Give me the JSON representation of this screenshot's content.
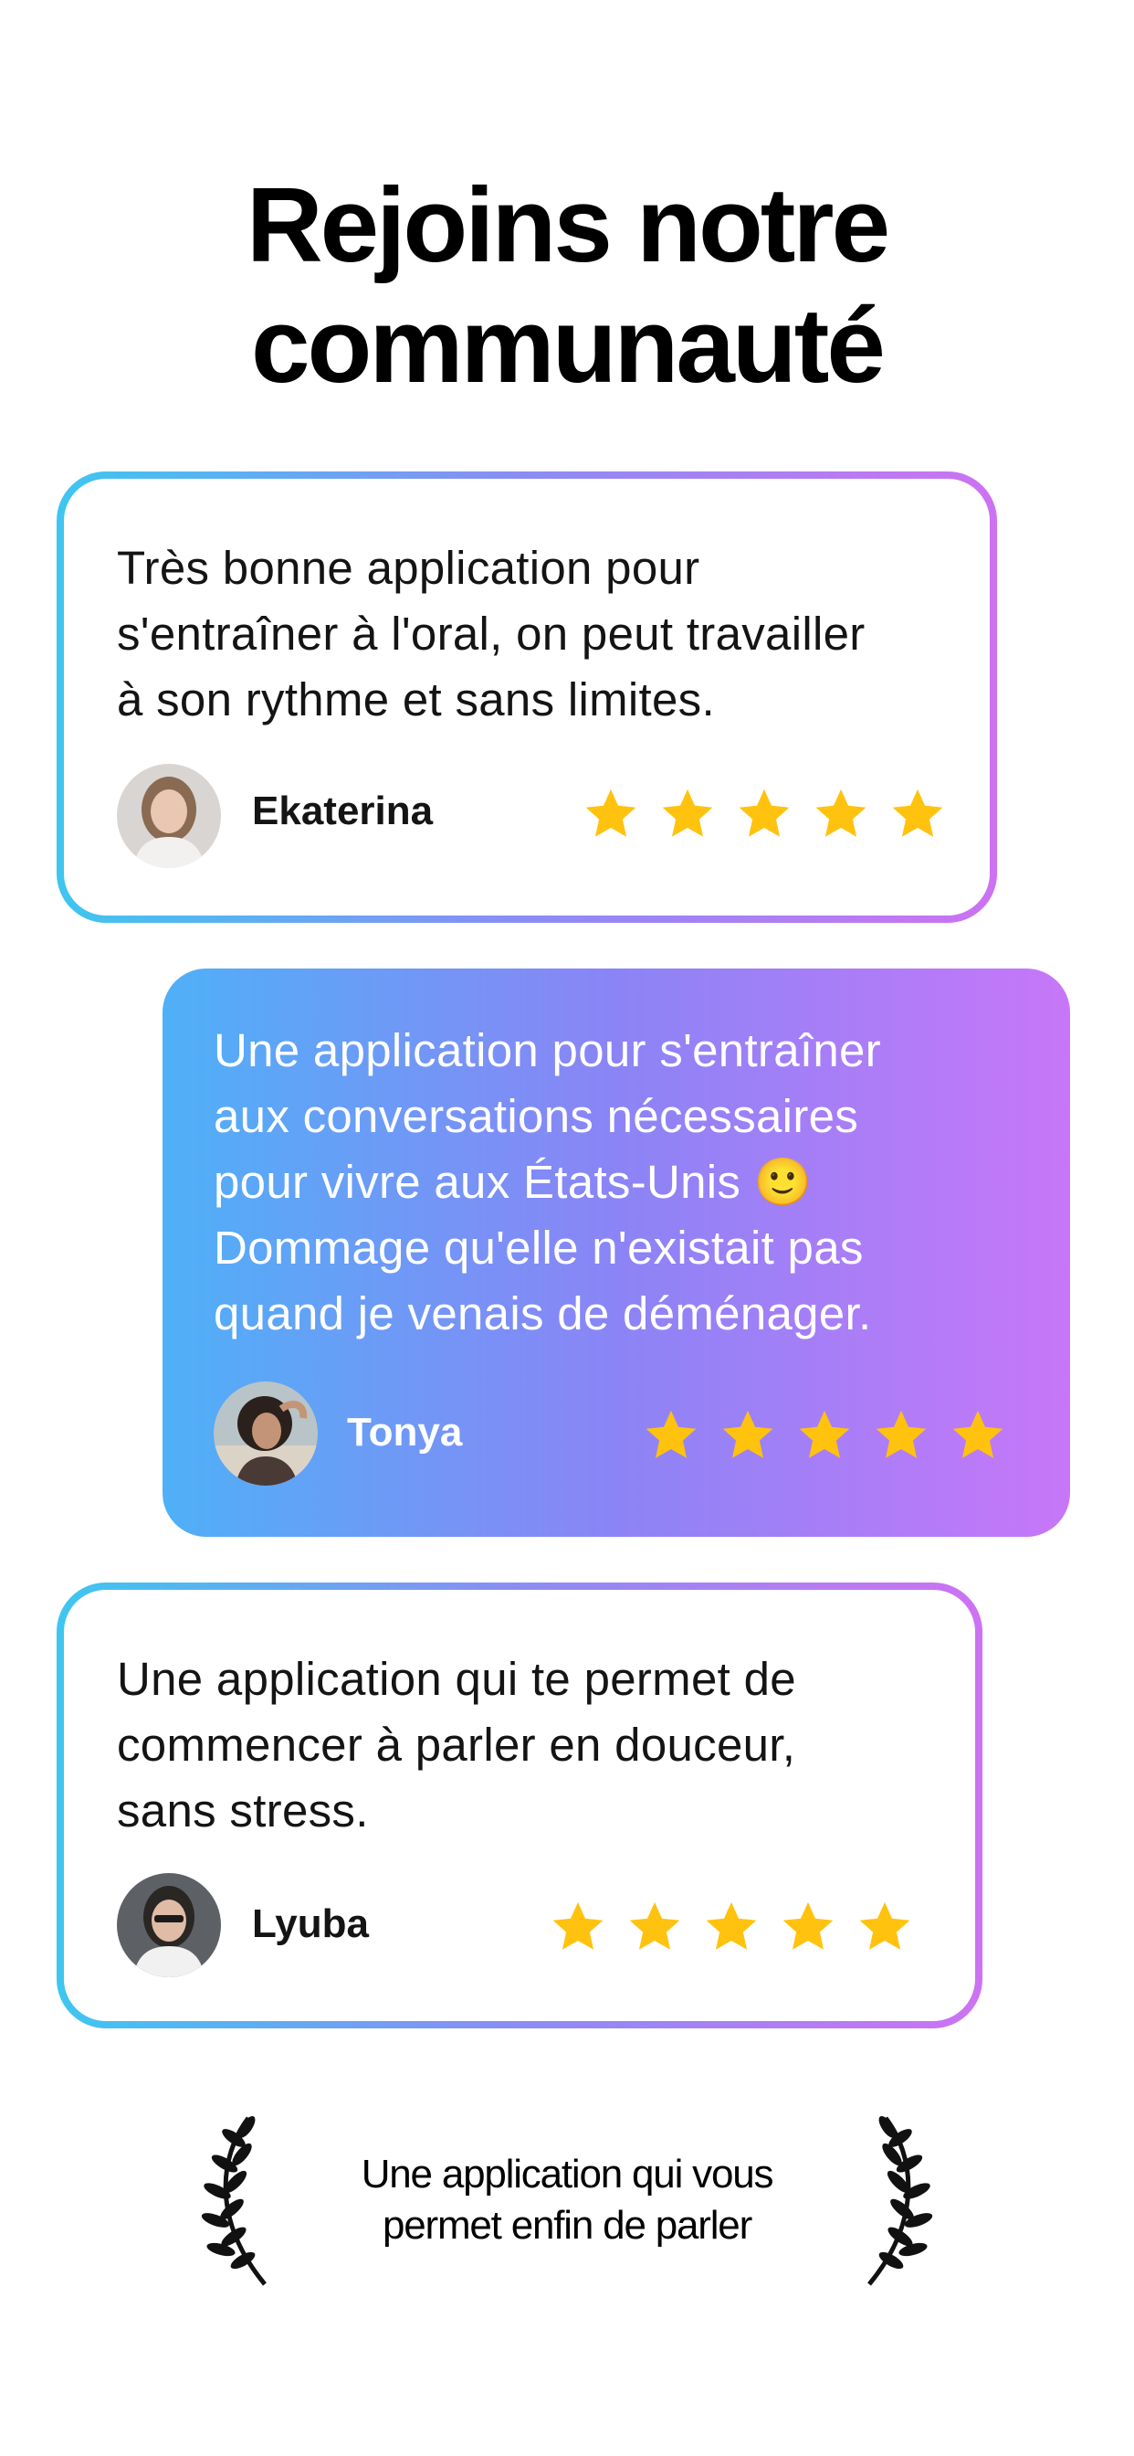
{
  "header": {
    "title_line1": "Rejoins notre",
    "title_line2": "communauté"
  },
  "reviews": [
    {
      "lines": [
        "Très bonne application pour",
        "s'entraîner à l'oral, on peut travailler",
        "à son rythme et sans limites."
      ],
      "name": "Ekaterina",
      "rating": 5,
      "style": "outlined"
    },
    {
      "lines": [
        "Une application pour s'entraîner",
        "aux conversations nécessaires",
        "pour vivre aux États-Unis 🙂",
        "Dommage qu'elle n'existait pas",
        "quand je venais de déménager."
      ],
      "name": "Tonya",
      "rating": 5,
      "style": "filled"
    },
    {
      "lines": [
        "Une application qui te permet de",
        "commencer à parler en douceur,",
        "sans stress."
      ],
      "name": "Lyuba",
      "rating": 5,
      "style": "outlined"
    }
  ],
  "award": {
    "line1": "Une application qui vous",
    "line2": "permet enfin de parler"
  },
  "colors": {
    "gradient_start": "#3ec6f0",
    "gradient_end": "#cd72f2",
    "star": "#FFC20E",
    "title": "#000000"
  },
  "icons": {
    "star": "star-icon",
    "laurel": "laurel-icon"
  }
}
